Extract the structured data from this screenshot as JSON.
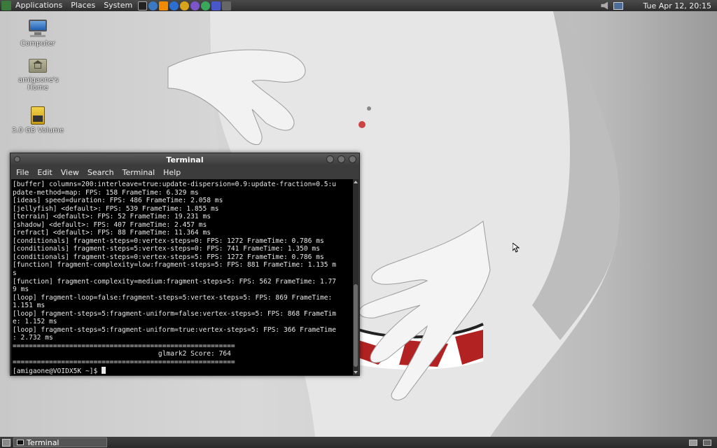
{
  "top_panel": {
    "menus": [
      "Applications",
      "Places",
      "System"
    ],
    "launchers": [
      {
        "icon": "terminal-launcher-icon",
        "color": "#222222"
      },
      {
        "icon": "network-globe-icon",
        "color": "#3a78c2"
      },
      {
        "icon": "vlc-cone-icon",
        "color": "#f08a00"
      },
      {
        "icon": "firefox-icon",
        "color": "#2c6fd1"
      },
      {
        "icon": "web-browser-icon",
        "color": "#d9a41c"
      },
      {
        "icon": "clementine-icon",
        "color": "#7a56c9"
      },
      {
        "icon": "settings-globe-icon",
        "color": "#3aa85a"
      },
      {
        "icon": "paint-brush-icon",
        "color": "#4a57c8"
      },
      {
        "icon": "image-viewer-icon",
        "color": "#666666"
      }
    ],
    "clock": "Tue Apr 12, 20:15"
  },
  "desktop_icons": [
    {
      "label": "Computer"
    },
    {
      "label": "amigaone's Home"
    },
    {
      "label": "3.0 GB Volume"
    }
  ],
  "terminal": {
    "title": "Terminal",
    "menu": [
      "File",
      "Edit",
      "View",
      "Search",
      "Terminal",
      "Help"
    ],
    "lines": [
      "[buffer] columns=200:interleave=true:update-dispersion=0.9:update-fraction=0.5:u",
      "pdate-method=map: FPS: 158 FrameTime: 6.329 ms",
      "[ideas] speed=duration: FPS: 486 FrameTime: 2.058 ms",
      "[jellyfish] <default>: FPS: 539 FrameTime: 1.855 ms",
      "[terrain] <default>: FPS: 52 FrameTime: 19.231 ms",
      "[shadow] <default>: FPS: 407 FrameTime: 2.457 ms",
      "[refract] <default>: FPS: 88 FrameTime: 11.364 ms",
      "[conditionals] fragment-steps=0:vertex-steps=0: FPS: 1272 FrameTime: 0.786 ms",
      "[conditionals] fragment-steps=5:vertex-steps=0: FPS: 741 FrameTime: 1.350 ms",
      "[conditionals] fragment-steps=0:vertex-steps=5: FPS: 1272 FrameTime: 0.786 ms",
      "[function] fragment-complexity=low:fragment-steps=5: FPS: 881 FrameTime: 1.135 m",
      "s",
      "[function] fragment-complexity=medium:fragment-steps=5: FPS: 562 FrameTime: 1.77",
      "9 ms",
      "[loop] fragment-loop=false:fragment-steps=5:vertex-steps=5: FPS: 869 FrameTime:",
      "1.151 ms",
      "[loop] fragment-steps=5:fragment-uniform=false:vertex-steps=5: FPS: 868 FrameTim",
      "e: 1.152 ms",
      "[loop] fragment-steps=5:fragment-uniform=true:vertex-steps=5: FPS: 366 FrameTime",
      ": 2.732 ms",
      "=======================================================",
      "                                    glmark2 Score: 764",
      "=======================================================",
      "[amigaone@VOIDX5K ~]$ "
    ]
  },
  "bottom_panel": {
    "task_label": "Terminal"
  }
}
